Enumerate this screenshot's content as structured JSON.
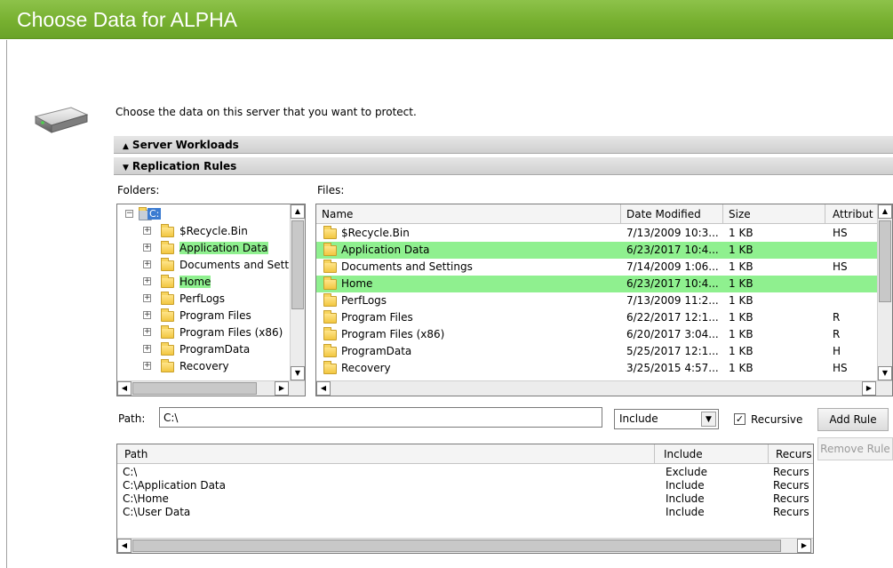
{
  "window": {
    "title": "Choose Data for ALPHA"
  },
  "instruction": "Choose the data on this server that you want to protect.",
  "sections": {
    "server_workloads": "Server Workloads",
    "replication_rules": "Replication Rules"
  },
  "labels": {
    "folders": "Folders:",
    "files": "Files:",
    "path": "Path:"
  },
  "folders_tree": {
    "root": "C:",
    "items": [
      {
        "label": "$Recycle.Bin",
        "highlighted": false
      },
      {
        "label": "Application Data",
        "highlighted": true
      },
      {
        "label": "Documents and Settir",
        "highlighted": false
      },
      {
        "label": "Home",
        "highlighted": true
      },
      {
        "label": "PerfLogs",
        "highlighted": false
      },
      {
        "label": "Program Files",
        "highlighted": false
      },
      {
        "label": "Program Files (x86)",
        "highlighted": false
      },
      {
        "label": "ProgramData",
        "highlighted": false
      },
      {
        "label": "Recovery",
        "highlighted": false
      }
    ]
  },
  "files_grid": {
    "columns": [
      "Name",
      "Date Modified",
      "Size",
      "Attribut"
    ],
    "rows": [
      {
        "name": "$Recycle.Bin",
        "date": "7/13/2009 10:3...",
        "size": "1 KB",
        "attr": "HS",
        "highlighted": false
      },
      {
        "name": "Application Data",
        "date": "6/23/2017 10:4...",
        "size": "1 KB",
        "attr": "",
        "highlighted": true
      },
      {
        "name": "Documents and Settings",
        "date": "7/14/2009 1:06...",
        "size": "1 KB",
        "attr": "HS",
        "highlighted": false
      },
      {
        "name": "Home",
        "date": "6/23/2017 10:4...",
        "size": "1 KB",
        "attr": "",
        "highlighted": true
      },
      {
        "name": "PerfLogs",
        "date": "7/13/2009 11:2...",
        "size": "1 KB",
        "attr": "",
        "highlighted": false
      },
      {
        "name": "Program Files",
        "date": "6/22/2017 12:1...",
        "size": "1 KB",
        "attr": "R",
        "highlighted": false
      },
      {
        "name": "Program Files (x86)",
        "date": "6/20/2017 3:04...",
        "size": "1 KB",
        "attr": "R",
        "highlighted": false
      },
      {
        "name": "ProgramData",
        "date": "5/25/2017 12:1...",
        "size": "1 KB",
        "attr": "H",
        "highlighted": false
      },
      {
        "name": "Recovery",
        "date": "3/25/2015 4:57...",
        "size": "1 KB",
        "attr": "HS",
        "highlighted": false
      }
    ]
  },
  "path_input": {
    "value": "C:\\"
  },
  "mode_select": {
    "value": "Include"
  },
  "recursive": {
    "label": "Recursive",
    "checked": true,
    "mark": "✓"
  },
  "buttons": {
    "add_rule": "Add Rule",
    "remove_rule": "Remove Rule"
  },
  "rules_grid": {
    "columns": [
      "Path",
      "Include",
      "Recurs"
    ],
    "rows": [
      {
        "path": "C:\\",
        "include": "Exclude",
        "recurs": "Recurs"
      },
      {
        "path": "C:\\Application Data",
        "include": "Include",
        "recurs": "Recurs"
      },
      {
        "path": "C:\\Home",
        "include": "Include",
        "recurs": "Recurs"
      },
      {
        "path": "C:\\User Data",
        "include": "Include",
        "recurs": "Recurs"
      }
    ]
  },
  "colors": {
    "title_green": "#77b030",
    "highlight": "#8ff08f"
  },
  "icons": {
    "drive": "hard-drive-icon",
    "folder": "folder-icon"
  }
}
